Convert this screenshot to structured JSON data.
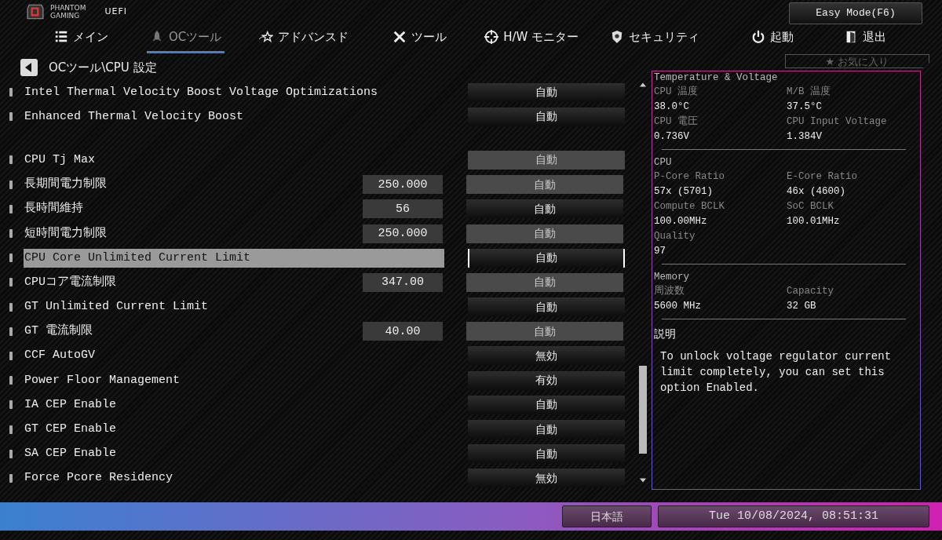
{
  "header": {
    "brand_line1": "PHANTOM",
    "brand_line2": "GAMING",
    "uefi": "UEFI",
    "easy_mode": "Easy Mode(F6)"
  },
  "tabs": [
    {
      "label": "メイン",
      "selected": false
    },
    {
      "label": "OCツール",
      "selected": true
    },
    {
      "label": "アドバンスド",
      "selected": false
    },
    {
      "label": "ツール",
      "selected": false
    },
    {
      "label": "H/W モニター",
      "selected": false
    },
    {
      "label": "セキュリティ",
      "selected": false
    },
    {
      "label": "起動",
      "selected": false
    },
    {
      "label": "退出",
      "selected": false
    }
  ],
  "breadcrumb": "OCツール\\CPU 設定",
  "favorites": "★ お気に入り",
  "setting_groups": [
    {
      "settings": [
        {
          "label": "Intel Thermal Velocity Boost Voltage Optimizations",
          "option": "自動",
          "dimmed": false,
          "selected": false
        },
        {
          "label": "Enhanced Thermal Velocity Boost",
          "option": "自動",
          "dimmed": false,
          "selected": false
        }
      ]
    },
    {
      "settings": [
        {
          "label": "CPU Tj Max",
          "option": "自動",
          "dimmed": true,
          "selected": false
        },
        {
          "label": "長期間電力制限",
          "value": "250.000",
          "option": "自動",
          "dimmed": true,
          "selected": false
        },
        {
          "label": "長時間維持",
          "value": "56",
          "option": "自動",
          "dimmed": false,
          "selected": false
        },
        {
          "label": "短時間電力制限",
          "value": "250.000",
          "option": "自動",
          "dimmed": true,
          "selected": false
        },
        {
          "label": "CPU Core Unlimited Current Limit",
          "option": "自動",
          "dimmed": false,
          "selected": true
        },
        {
          "label": "CPUコア電流制限",
          "value": "347.00",
          "option": "自動",
          "dimmed": true,
          "selected": false
        },
        {
          "label": "GT Unlimited Current Limit",
          "option": "自動",
          "dimmed": false,
          "selected": false
        },
        {
          "label": "GT 電流制限",
          "value": "40.00",
          "option": "自動",
          "dimmed": true,
          "selected": false
        },
        {
          "label": "CCF AutoGV",
          "option": "無効",
          "dimmed": false,
          "selected": false
        },
        {
          "label": "Power Floor Management",
          "option": "有効",
          "dimmed": false,
          "selected": false
        },
        {
          "label": "IA CEP Enable",
          "option": "自動",
          "dimmed": false,
          "selected": false
        },
        {
          "label": "GT CEP Enable",
          "option": "自動",
          "dimmed": false,
          "selected": false
        },
        {
          "label": "SA CEP Enable",
          "option": "自動",
          "dimmed": false,
          "selected": false
        },
        {
          "label": "Force Pcore Residency",
          "option": "無効",
          "dimmed": false,
          "selected": false
        }
      ]
    }
  ],
  "monitor": {
    "sections": [
      {
        "title": "Temperature & Voltage",
        "items": [
          {
            "label": "CPU 温度",
            "value": "38.0°C"
          },
          {
            "label": "M/B 温度",
            "value": "37.5°C"
          },
          {
            "label": "CPU 電圧",
            "value": "0.736V"
          },
          {
            "label": "CPU Input Voltage",
            "value": "1.384V"
          }
        ]
      },
      {
        "title": "CPU",
        "items": [
          {
            "label": "P-Core Ratio",
            "value": "57x (5701)"
          },
          {
            "label": "E-Core Ratio",
            "value": "46x (4600)"
          },
          {
            "label": "Compute BCLK",
            "value": "100.00MHz"
          },
          {
            "label": "SoC BCLK",
            "value": "100.01MHz"
          },
          {
            "label": "Quality",
            "value": "97"
          }
        ]
      },
      {
        "title": "Memory",
        "items": [
          {
            "label": "周波数",
            "value": "5600 MHz"
          },
          {
            "label": "Capacity",
            "value": "32 GB"
          }
        ]
      }
    ]
  },
  "description": {
    "title": "説明",
    "text": "To unlock voltage regulator current limit completely, you can set this option Enabled."
  },
  "status_bar": {
    "language": "日本語",
    "datetime": "Tue 10/08/2024, 08:51:31"
  }
}
